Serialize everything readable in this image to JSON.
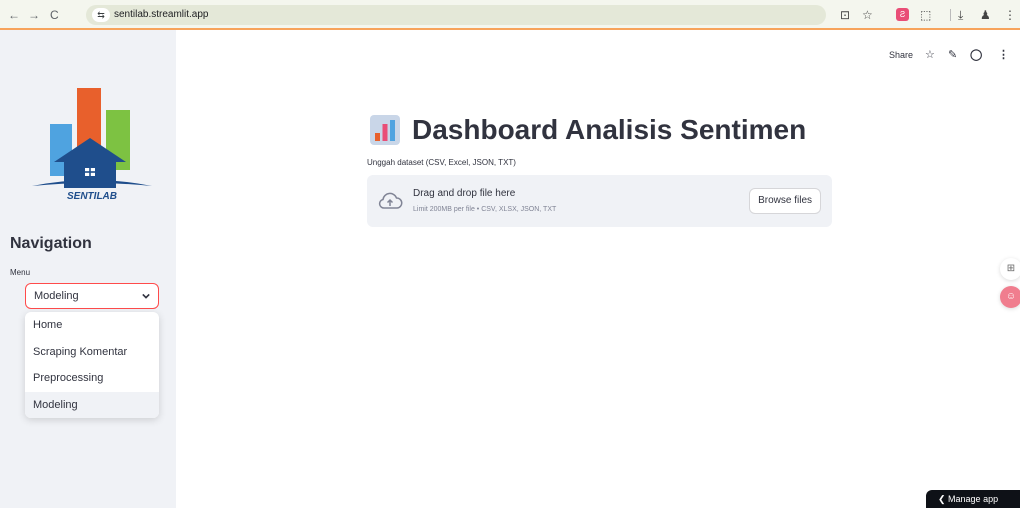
{
  "browser": {
    "url": "sentilab.streamlit.app",
    "back_icon": "←",
    "forward_icon": "→",
    "reload_icon": "C",
    "site_info_icon": "⇆",
    "toolbar_icons": [
      "⊡",
      "☆",
      "Ƨ",
      "⬚",
      "⤓",
      "♟",
      "⋮"
    ]
  },
  "sidebar": {
    "logo_text": "SENTILAB",
    "nav_title": "Navigation",
    "menu_label": "Menu",
    "selected": "Modeling",
    "options": [
      "Home",
      "Scraping Komentar",
      "Preprocessing",
      "Modeling"
    ]
  },
  "topbar": {
    "share_label": "Share",
    "star_icon": "☆",
    "edit_icon": "✎",
    "github_icon": "◯",
    "more_icon": "⋮"
  },
  "main": {
    "title": "Dashboard Analisis Sentimen",
    "upload_label": "Unggah dataset (CSV, Excel, JSON, TXT)",
    "dropzone_text": "Drag and drop file here",
    "dropzone_limit": "Limit 200MB per file • CSV, XLSX, JSON, TXT",
    "browse_label": "Browse files"
  },
  "floating": {
    "grid_icon": "⊞",
    "badge_icon": "☺"
  },
  "manage_app": "❮   Manage app",
  "colors": {
    "accent": "#ff4b4b",
    "sidebar_bg": "#f0f2f6",
    "text": "#31333f"
  }
}
